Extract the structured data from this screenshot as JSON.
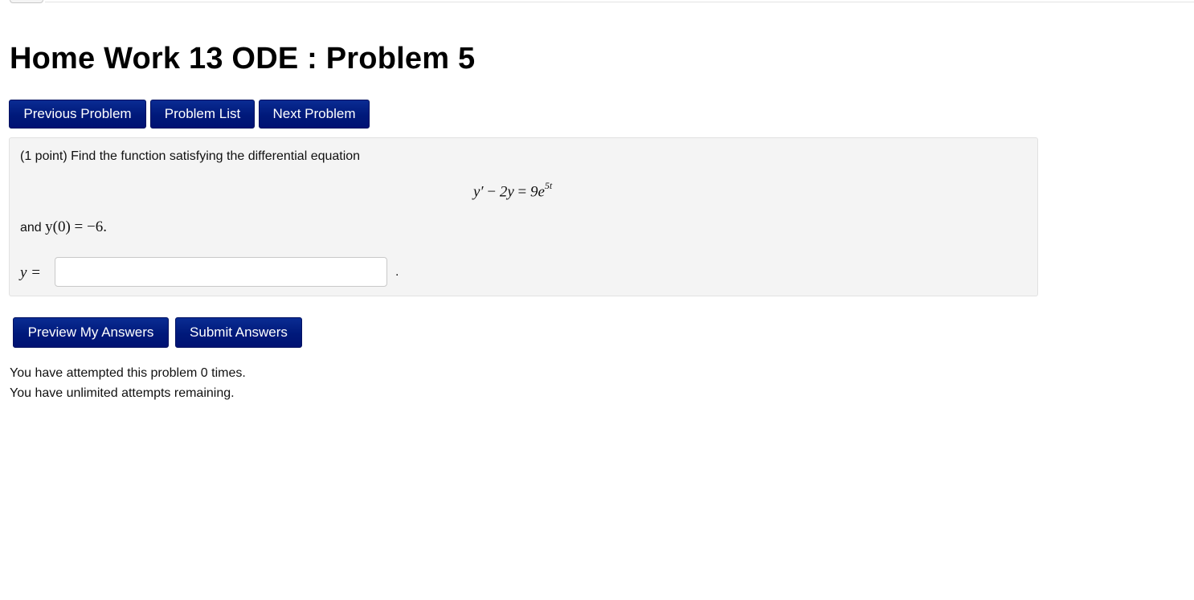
{
  "page": {
    "title": "Home Work 13 ODE : Problem 5"
  },
  "nav": {
    "previous_label": "Previous Problem",
    "list_label": "Problem List",
    "next_label": "Next Problem"
  },
  "problem": {
    "intro": "(1 point) Find the function satisfying the differential equation",
    "equation": {
      "lhs_y_prime": "y′",
      "minus": " − ",
      "term": "2y",
      "equals": " = ",
      "coef": "9e",
      "exponent": "5t"
    },
    "initial_prefix": "and ",
    "initial_condition": "y(0) = −6",
    "initial_suffix": ".",
    "answer_label": "y =",
    "answer_value": "",
    "answer_suffix": "."
  },
  "actions": {
    "preview_label": "Preview My Answers",
    "submit_label": "Submit Answers"
  },
  "status": {
    "attempts": "You have attempted this problem 0 times.",
    "remaining": "You have unlimited attempts remaining."
  },
  "colors": {
    "button_bg": "#00197a",
    "panel_bg": "#f4f4f4"
  }
}
